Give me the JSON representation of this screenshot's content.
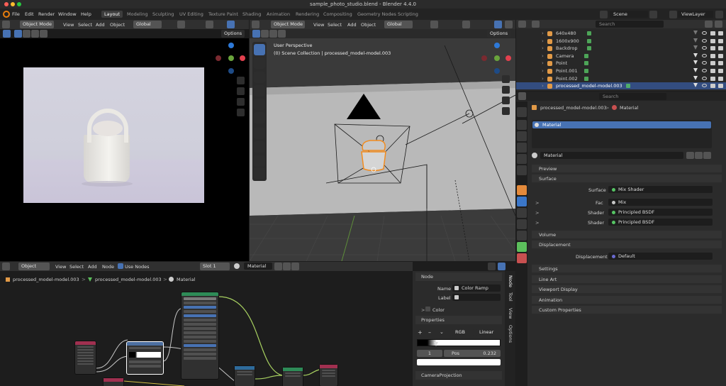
{
  "mac": {
    "title": "sample_photo_studio.blend - Blender 4.4.0"
  },
  "menubar": {
    "items": [
      "File",
      "Edit",
      "Render",
      "Window",
      "Help"
    ],
    "workspaces": [
      "Layout",
      "Modeling",
      "Sculpting",
      "UV Editing",
      "Texture Paint",
      "Shading",
      "Animation",
      "Rendering",
      "Compositing",
      "Geometry Nodes",
      "Scripting"
    ],
    "active_workspace": "Layout",
    "scene": "Scene",
    "view_layer": "ViewLayer"
  },
  "left_viewport": {
    "mode": "Object Mode",
    "menus": [
      "View",
      "Select",
      "Add",
      "Object"
    ],
    "orientation": "Global",
    "options": "Options"
  },
  "main_viewport": {
    "mode": "Object Mode",
    "menus": [
      "View",
      "Select",
      "Add",
      "Object"
    ],
    "orientation": "Global",
    "options": "Options",
    "overlay_line1": "User Perspective",
    "overlay_line2": "(0) Scene Collection | processed_model-model.003"
  },
  "outliner": {
    "search_placeholder": "Search",
    "items": [
      {
        "name": "640x480",
        "icon": "image-icon",
        "color": "#e29a47",
        "selected": false
      },
      {
        "name": "1600x900",
        "icon": "image-icon",
        "color": "#e29a47",
        "selected": false
      },
      {
        "name": "Backdrop",
        "icon": "mesh-icon",
        "color": "#e29a47",
        "selected": false
      },
      {
        "name": "Camera",
        "icon": "camera-icon",
        "color": "#e29a47",
        "selected": false
      },
      {
        "name": "Point",
        "icon": "light-icon",
        "color": "#e29a47",
        "selected": false
      },
      {
        "name": "Point.001",
        "icon": "light-icon",
        "color": "#e29a47",
        "selected": false
      },
      {
        "name": "Point.002",
        "icon": "light-icon",
        "color": "#e29a47",
        "selected": false
      },
      {
        "name": "processed_model-model.003",
        "icon": "mesh-icon",
        "color": "#e29a47",
        "selected": true
      }
    ]
  },
  "properties": {
    "search_placeholder": "Search",
    "breadcrumb_object": "processed_model-model.003",
    "breadcrumb_material": "Material",
    "slot_name": "Material",
    "material_name": "Material",
    "sections": {
      "preview": "Preview",
      "surface": "Surface",
      "volume": "Volume",
      "displacement": "Displacement",
      "settings": "Settings",
      "line_art": "Line Art",
      "viewport_display": "Viewport Display",
      "animation": "Animation",
      "custom_properties": "Custom Properties"
    },
    "surface_label": "Surface",
    "surface_value": "Mix Shader",
    "fac_label": "Fac",
    "fac_value": "Mix",
    "shader1_label": "Shader",
    "shader1_value": "Principled BSDF",
    "shader2_label": "Shader",
    "shader2_value": "Principled BSDF",
    "disp_label": "Displacement",
    "disp_value": "Default"
  },
  "node_editor": {
    "mode": "Object",
    "menus": [
      "View",
      "Select",
      "Add",
      "Node"
    ],
    "use_nodes": "Use Nodes",
    "slot": "Slot 1",
    "material": "Material",
    "breadcrumb": [
      "processed_model-model.003",
      "processed_model-model.003",
      "Material"
    ]
  },
  "node_sidebar": {
    "section_node": "Node",
    "name_label": "Name",
    "name_value": "Color Ramp",
    "label_label": "Label",
    "label_value": "",
    "color_label": "Color",
    "section_properties": "Properties",
    "color_mode": "RGB",
    "interpolation": "Linear",
    "stop_index": "1",
    "pos_label": "Pos",
    "pos_value": "0.232",
    "section_camera": "CameraProjection",
    "tabs": [
      "Node",
      "Tool",
      "View",
      "Options"
    ]
  }
}
